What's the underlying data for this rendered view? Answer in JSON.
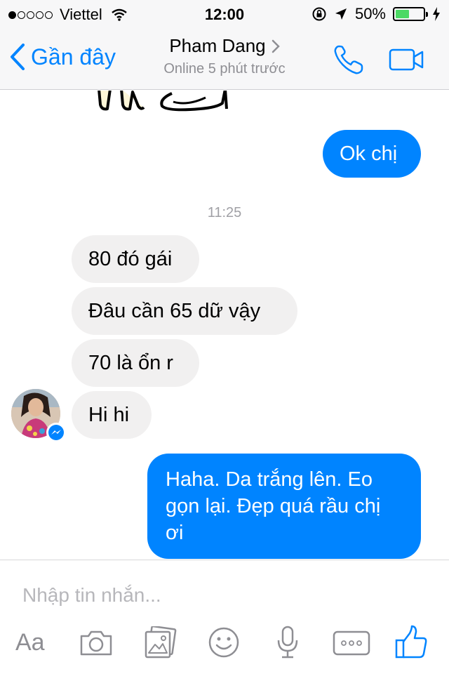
{
  "status_bar": {
    "carrier": "Viettel",
    "time": "12:00",
    "battery": "50%",
    "battery_level": 0.5
  },
  "nav": {
    "back_label": "Gần đây",
    "contact_name": "Pham Dang",
    "contact_status": "Online 5 phút trước"
  },
  "chat": {
    "messages": [
      {
        "from": "me",
        "text": "Ok chị"
      },
      {
        "from": "them",
        "text": "80 đó gái"
      },
      {
        "from": "them",
        "text": "Đâu cần 65 dữ vậy"
      },
      {
        "from": "them",
        "text": "70 là ổn r"
      },
      {
        "from": "them",
        "text": "Hi hi"
      },
      {
        "from": "me",
        "text": "Haha. Da trắng lên. Eo gọn lại. Đẹp quá rầu chị ơi"
      }
    ],
    "timestamp": "11:25"
  },
  "composer": {
    "placeholder": "Nhập tin nhắn...",
    "aa_label": "Aa",
    "icons": [
      "aa-icon",
      "camera-icon",
      "gallery-icon",
      "emoji-icon",
      "microphone-icon",
      "more-icon",
      "thumbs-up-icon"
    ]
  },
  "colors": {
    "accent": "#0084ff",
    "incoming_bubble": "#f1f0f0",
    "battery_fill": "#4cd964"
  }
}
